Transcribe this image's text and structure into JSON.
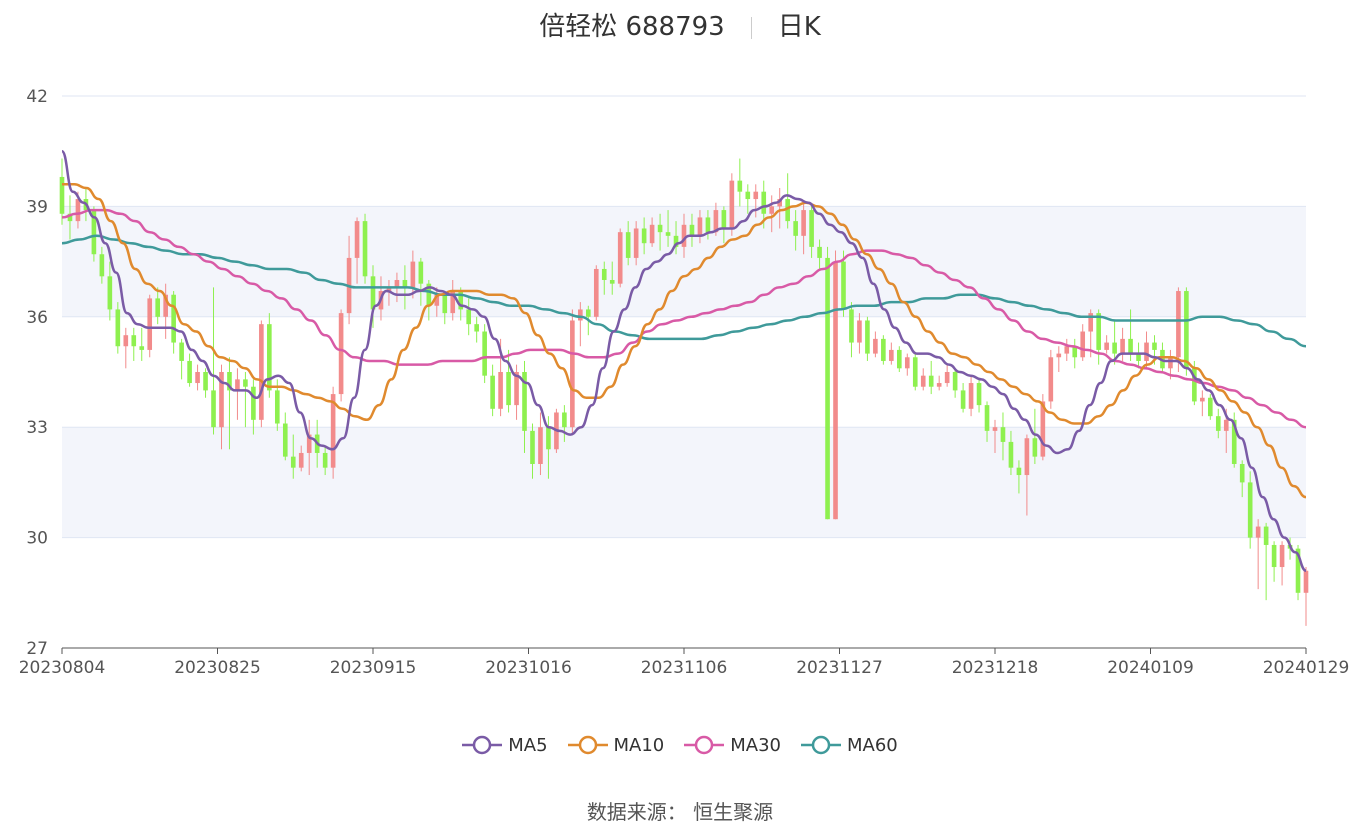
{
  "title": {
    "name": "倍轻松 688793",
    "period": "日K"
  },
  "source": "数据来源： 恒生聚源",
  "colors": {
    "up": "#f28b8b",
    "down": "#8ef04f",
    "ma5": "#7a5ba6",
    "ma10": "#e08a2e",
    "ma30": "#d85aa6",
    "ma60": "#3f9a9a",
    "band": "#f3f5fb",
    "grid": "#dfe6f3"
  },
  "chart_data": {
    "type": "candlestick",
    "ylim": [
      27,
      42
    ],
    "yticks": [
      27,
      30,
      33,
      36,
      39,
      42
    ],
    "xticks": [
      "20230804",
      "20230825",
      "20230915",
      "20231016",
      "20231106",
      "20231127",
      "20231218",
      "20240109",
      "20240129"
    ],
    "legend": [
      "MA5",
      "MA10",
      "MA30",
      "MA60"
    ],
    "legend_position": "bottom",
    "candles": [
      [
        39.8,
        38.8,
        40.3,
        38.5
      ],
      [
        38.8,
        38.6,
        39.3,
        38.1
      ],
      [
        38.6,
        39.2,
        39.4,
        38.4
      ],
      [
        39.2,
        38.9,
        39.5,
        38.6
      ],
      [
        38.9,
        37.7,
        39.0,
        37.5
      ],
      [
        37.7,
        37.1,
        37.9,
        36.9
      ],
      [
        37.1,
        36.2,
        37.5,
        35.9
      ],
      [
        36.2,
        35.2,
        36.4,
        35.0
      ],
      [
        35.2,
        35.5,
        35.7,
        34.6
      ],
      [
        35.5,
        35.2,
        35.7,
        34.8
      ],
      [
        35.2,
        35.1,
        35.7,
        34.8
      ],
      [
        35.1,
        36.5,
        36.6,
        34.9
      ],
      [
        36.5,
        36.0,
        36.8,
        35.8
      ],
      [
        36.0,
        36.6,
        36.9,
        35.4
      ],
      [
        36.6,
        35.3,
        36.7,
        35.0
      ],
      [
        35.3,
        34.8,
        35.4,
        34.3
      ],
      [
        34.8,
        34.2,
        35.0,
        34.1
      ],
      [
        34.2,
        34.5,
        34.7,
        34.0
      ],
      [
        34.5,
        34.0,
        34.6,
        33.8
      ],
      [
        34.0,
        33.0,
        36.8,
        32.8
      ],
      [
        33.0,
        34.5,
        34.7,
        32.4
      ],
      [
        34.5,
        34.0,
        34.9,
        32.4
      ],
      [
        34.0,
        34.3,
        34.6,
        33.2
      ],
      [
        34.3,
        34.1,
        34.5,
        33.0
      ],
      [
        34.1,
        33.2,
        34.3,
        32.8
      ],
      [
        33.2,
        35.8,
        35.9,
        33.0
      ],
      [
        35.8,
        34.0,
        36.1,
        33.8
      ],
      [
        34.0,
        33.1,
        34.3,
        32.9
      ],
      [
        33.1,
        32.2,
        33.4,
        32.1
      ],
      [
        32.2,
        31.9,
        32.8,
        31.6
      ],
      [
        31.9,
        32.3,
        32.5,
        31.8
      ],
      [
        32.3,
        32.8,
        33.2,
        31.7
      ],
      [
        32.8,
        32.3,
        33.2,
        31.9
      ],
      [
        32.3,
        31.9,
        32.5,
        31.7
      ],
      [
        31.9,
        33.9,
        34.1,
        31.6
      ],
      [
        33.9,
        36.1,
        36.2,
        33.7
      ],
      [
        36.1,
        37.6,
        38.2,
        35.8
      ],
      [
        37.6,
        38.6,
        38.7,
        36.9
      ],
      [
        38.6,
        37.1,
        38.8,
        36.9
      ],
      [
        37.1,
        36.2,
        37.4,
        35.7
      ],
      [
        36.2,
        36.7,
        37.1,
        35.9
      ],
      [
        36.7,
        36.8,
        37.0,
        36.3
      ],
      [
        36.8,
        37.0,
        37.2,
        36.4
      ],
      [
        37.0,
        36.8,
        37.4,
        36.2
      ],
      [
        36.8,
        37.5,
        37.8,
        36.5
      ],
      [
        37.5,
        36.9,
        37.6,
        36.3
      ],
      [
        36.9,
        36.3,
        37.0,
        35.9
      ],
      [
        36.3,
        36.6,
        36.8,
        36.0
      ],
      [
        36.6,
        36.1,
        36.7,
        35.8
      ],
      [
        36.1,
        36.7,
        37.0,
        35.9
      ],
      [
        36.7,
        36.2,
        36.8,
        35.9
      ],
      [
        36.2,
        35.8,
        36.5,
        35.5
      ],
      [
        35.8,
        35.6,
        36.0,
        35.3
      ],
      [
        35.6,
        34.4,
        35.8,
        34.2
      ],
      [
        34.4,
        33.5,
        34.7,
        33.3
      ],
      [
        33.5,
        34.5,
        35.4,
        33.3
      ],
      [
        34.5,
        33.6,
        35.1,
        33.4
      ],
      [
        33.6,
        34.5,
        34.7,
        33.2
      ],
      [
        34.5,
        32.9,
        34.8,
        32.3
      ],
      [
        32.9,
        32.0,
        33.1,
        31.6
      ],
      [
        32.0,
        33.0,
        33.4,
        31.7
      ],
      [
        33.0,
        32.4,
        33.3,
        31.6
      ],
      [
        32.4,
        33.4,
        33.5,
        32.3
      ],
      [
        33.4,
        33.0,
        33.6,
        32.6
      ],
      [
        33.0,
        35.9,
        36.2,
        32.8
      ],
      [
        35.9,
        36.2,
        36.4,
        35.2
      ],
      [
        36.2,
        36.0,
        36.3,
        35.5
      ],
      [
        36.0,
        37.3,
        37.4,
        35.9
      ],
      [
        37.3,
        37.0,
        37.5,
        36.6
      ],
      [
        37.0,
        36.9,
        37.5,
        36.6
      ],
      [
        36.9,
        38.3,
        38.4,
        36.8
      ],
      [
        38.3,
        37.6,
        38.6,
        37.4
      ],
      [
        37.6,
        38.4,
        38.6,
        37.4
      ],
      [
        38.4,
        38.0,
        38.7,
        37.7
      ],
      [
        38.0,
        38.5,
        38.7,
        37.9
      ],
      [
        38.5,
        38.3,
        38.8,
        37.8
      ],
      [
        38.3,
        38.2,
        38.9,
        37.9
      ],
      [
        38.2,
        37.9,
        38.6,
        37.7
      ],
      [
        37.9,
        38.5,
        38.8,
        37.6
      ],
      [
        38.5,
        38.2,
        38.8,
        37.9
      ],
      [
        38.2,
        38.7,
        38.9,
        38.0
      ],
      [
        38.7,
        38.3,
        38.9,
        38.1
      ],
      [
        38.3,
        38.9,
        39.1,
        38.2
      ],
      [
        38.9,
        38.4,
        39.0,
        38.0
      ],
      [
        38.4,
        39.7,
        39.9,
        38.2
      ],
      [
        39.7,
        39.4,
        40.3,
        39.0
      ],
      [
        39.4,
        39.2,
        39.6,
        38.8
      ],
      [
        39.2,
        39.4,
        39.6,
        38.7
      ],
      [
        39.4,
        38.8,
        39.7,
        38.4
      ],
      [
        38.8,
        39.0,
        39.3,
        38.3
      ],
      [
        39.0,
        39.2,
        39.5,
        38.4
      ],
      [
        39.2,
        38.6,
        39.9,
        38.4
      ],
      [
        38.6,
        38.2,
        38.9,
        37.8
      ],
      [
        38.2,
        38.9,
        39.1,
        37.7
      ],
      [
        38.9,
        37.9,
        39.0,
        37.6
      ],
      [
        37.9,
        37.6,
        38.1,
        37.3
      ],
      [
        37.6,
        30.5,
        37.9,
        30.5
      ],
      [
        30.5,
        37.5,
        37.8,
        30.5
      ],
      [
        37.5,
        36.2,
        37.8,
        36.0
      ],
      [
        36.2,
        35.3,
        36.4,
        34.9
      ],
      [
        35.3,
        35.9,
        36.1,
        35.0
      ],
      [
        35.9,
        35.0,
        36.0,
        34.8
      ],
      [
        35.0,
        35.4,
        35.6,
        34.9
      ],
      [
        35.4,
        34.8,
        35.5,
        34.7
      ],
      [
        34.8,
        35.1,
        35.3,
        34.7
      ],
      [
        35.1,
        34.6,
        35.2,
        34.5
      ],
      [
        34.6,
        34.9,
        35.0,
        34.4
      ],
      [
        34.9,
        34.1,
        35.0,
        34.0
      ],
      [
        34.1,
        34.4,
        34.6,
        34.0
      ],
      [
        34.4,
        34.1,
        34.8,
        33.9
      ],
      [
        34.1,
        34.2,
        34.4,
        34.0
      ],
      [
        34.2,
        34.5,
        34.7,
        34.1
      ],
      [
        34.5,
        34.0,
        34.6,
        33.8
      ],
      [
        34.0,
        33.5,
        34.2,
        33.4
      ],
      [
        33.5,
        34.2,
        34.4,
        33.3
      ],
      [
        34.2,
        33.6,
        34.3,
        33.4
      ],
      [
        33.6,
        32.9,
        33.7,
        32.6
      ],
      [
        32.9,
        33.0,
        33.2,
        32.3
      ],
      [
        33.0,
        32.6,
        33.4,
        32.1
      ],
      [
        32.6,
        31.9,
        32.9,
        31.7
      ],
      [
        31.9,
        31.7,
        32.1,
        31.2
      ],
      [
        31.7,
        32.7,
        32.8,
        30.6
      ],
      [
        32.7,
        32.2,
        33.5,
        32.0
      ],
      [
        32.2,
        33.7,
        33.9,
        32.1
      ],
      [
        33.7,
        34.9,
        35.1,
        33.5
      ],
      [
        34.9,
        35.0,
        35.2,
        34.5
      ],
      [
        35.0,
        35.2,
        35.4,
        34.8
      ],
      [
        35.2,
        34.9,
        35.4,
        34.6
      ],
      [
        34.9,
        35.6,
        35.8,
        34.8
      ],
      [
        35.6,
        36.1,
        36.2,
        34.9
      ],
      [
        36.1,
        35.1,
        36.2,
        34.7
      ],
      [
        35.1,
        35.3,
        35.5,
        35.0
      ],
      [
        35.3,
        35.0,
        35.9,
        34.7
      ],
      [
        35.0,
        35.4,
        35.7,
        34.8
      ],
      [
        35.4,
        35.0,
        36.2,
        34.8
      ],
      [
        35.0,
        34.8,
        35.3,
        34.6
      ],
      [
        34.8,
        35.3,
        35.6,
        34.6
      ],
      [
        35.3,
        35.1,
        35.5,
        34.7
      ],
      [
        35.1,
        34.6,
        35.3,
        34.5
      ],
      [
        34.6,
        34.9,
        35.1,
        34.3
      ],
      [
        34.9,
        36.7,
        36.8,
        34.5
      ],
      [
        36.7,
        34.6,
        36.8,
        34.4
      ],
      [
        34.6,
        33.7,
        34.8,
        33.6
      ],
      [
        33.7,
        33.8,
        34.0,
        33.3
      ],
      [
        33.8,
        33.3,
        33.9,
        33.2
      ],
      [
        33.3,
        32.9,
        33.5,
        32.7
      ],
      [
        32.9,
        33.2,
        33.5,
        32.3
      ],
      [
        33.2,
        32.0,
        33.4,
        31.9
      ],
      [
        32.0,
        31.5,
        32.1,
        31.1
      ],
      [
        31.5,
        30.0,
        31.8,
        29.7
      ],
      [
        30.0,
        30.3,
        30.5,
        28.6
      ],
      [
        30.3,
        29.8,
        30.4,
        28.3
      ],
      [
        29.8,
        29.2,
        29.9,
        28.8
      ],
      [
        29.2,
        29.8,
        29.9,
        28.7
      ],
      [
        29.8,
        29.7,
        30.0,
        29.4
      ],
      [
        29.7,
        28.5,
        29.8,
        28.3
      ],
      [
        28.5,
        29.1,
        29.2,
        27.6
      ]
    ],
    "ma5": [
      40.5,
      39.4,
      39.1,
      38.7,
      38.0,
      37.2,
      36.1,
      35.8,
      35.7,
      35.7,
      35.7,
      35.6,
      35.1,
      34.8,
      34.4,
      34.2,
      34.0,
      34.0,
      33.8,
      34.3,
      34.4,
      34.2,
      33.4,
      32.7,
      32.5,
      32.4,
      32.7,
      33.8,
      35.1,
      36.3,
      36.7,
      36.6,
      36.6,
      36.7,
      36.8,
      36.7,
      36.6,
      36.3,
      36.2,
      36.0,
      35.4,
      34.8,
      34.4,
      34.2,
      33.6,
      33.0,
      32.9,
      32.8,
      33.0,
      33.6,
      34.6,
      35.6,
      36.2,
      36.8,
      37.3,
      37.5,
      37.7,
      38.0,
      38.2,
      38.2,
      38.3,
      38.4,
      38.4,
      38.6,
      38.9,
      39.0,
      39.1,
      39.3,
      39.2,
      39.1,
      38.8,
      38.5,
      38.3,
      38.0,
      37.6,
      36.9,
      36.2,
      35.7,
      35.3,
      35.0,
      35.0,
      34.9,
      34.7,
      34.5,
      34.4,
      34.3,
      34.1,
      33.9,
      33.5,
      33.2,
      32.8,
      32.5,
      32.3,
      32.4,
      32.9,
      33.6,
      34.2,
      34.8,
      35.0,
      35.0,
      35.0,
      34.9,
      34.8,
      34.8,
      34.6,
      34.3,
      34.0,
      33.6,
      33.2,
      32.7,
      31.9,
      31.1,
      30.5,
      30.0,
      29.6,
      29.1
    ],
    "ma10": [
      39.6,
      39.6,
      39.5,
      39.2,
      38.6,
      38.0,
      37.3,
      36.9,
      36.7,
      36.3,
      35.8,
      35.6,
      35.2,
      34.9,
      34.8,
      34.6,
      34.3,
      34.1,
      34.1,
      34.0,
      33.9,
      33.8,
      33.7,
      33.5,
      33.3,
      33.2,
      33.6,
      34.3,
      35.1,
      35.7,
      36.3,
      36.6,
      36.7,
      36.7,
      36.7,
      36.6,
      36.6,
      36.5,
      36.1,
      35.5,
      35.0,
      34.6,
      34.0,
      33.8,
      33.8,
      34.1,
      34.7,
      35.2,
      35.8,
      36.2,
      36.7,
      37.1,
      37.3,
      37.6,
      37.9,
      38.1,
      38.2,
      38.5,
      38.7,
      38.9,
      39.0,
      39.1,
      39.0,
      38.8,
      38.5,
      38.1,
      37.7,
      37.3,
      36.9,
      36.4,
      36.0,
      35.6,
      35.3,
      35.0,
      34.9,
      34.7,
      34.5,
      34.3,
      34.1,
      33.9,
      33.7,
      33.4,
      33.2,
      33.1,
      33.1,
      33.3,
      33.6,
      34.0,
      34.4,
      34.7,
      34.9,
      34.9,
      34.8,
      34.6,
      34.3,
      34.0,
      33.7,
      33.4,
      33.0,
      32.5,
      31.9,
      31.4,
      31.1
    ],
    "ma30": [
      38.7,
      38.8,
      38.9,
      38.9,
      38.8,
      38.6,
      38.3,
      38.1,
      37.9,
      37.7,
      37.5,
      37.3,
      37.1,
      36.9,
      36.7,
      36.5,
      36.2,
      35.9,
      35.5,
      35.1,
      34.9,
      34.8,
      34.8,
      34.7,
      34.7,
      34.7,
      34.8,
      34.8,
      34.8,
      34.9,
      34.9,
      35.0,
      35.1,
      35.1,
      35.1,
      35.0,
      34.9,
      34.9,
      35.0,
      35.3,
      35.6,
      35.8,
      35.9,
      36.0,
      36.1,
      36.2,
      36.3,
      36.4,
      36.6,
      36.8,
      36.9,
      37.1,
      37.3,
      37.5,
      37.7,
      37.8,
      37.8,
      37.7,
      37.6,
      37.4,
      37.2,
      37.0,
      36.8,
      36.5,
      36.2,
      35.9,
      35.6,
      35.4,
      35.3,
      35.2,
      35.1,
      35.0,
      34.8,
      34.7,
      34.6,
      34.5,
      34.4,
      34.3,
      34.2,
      34.1,
      34.0,
      33.8,
      33.6,
      33.4,
      33.2,
      33.0
    ],
    "ma60": [
      38.0,
      38.1,
      38.2,
      38.1,
      38.0,
      37.9,
      37.8,
      37.7,
      37.7,
      37.6,
      37.5,
      37.4,
      37.3,
      37.3,
      37.2,
      37.0,
      36.9,
      36.8,
      36.8,
      36.8,
      36.8,
      36.7,
      36.6,
      36.6,
      36.5,
      36.4,
      36.3,
      36.3,
      36.2,
      36.1,
      36.0,
      35.8,
      35.6,
      35.5,
      35.4,
      35.4,
      35.4,
      35.4,
      35.5,
      35.6,
      35.7,
      35.8,
      35.9,
      36.0,
      36.1,
      36.2,
      36.3,
      36.3,
      36.4,
      36.4,
      36.5,
      36.5,
      36.6,
      36.6,
      36.5,
      36.4,
      36.3,
      36.2,
      36.1,
      36.0,
      36.0,
      35.9,
      35.9,
      35.9,
      35.9,
      35.9,
      36.0,
      36.0,
      35.9,
      35.8,
      35.6,
      35.4,
      35.2
    ]
  }
}
